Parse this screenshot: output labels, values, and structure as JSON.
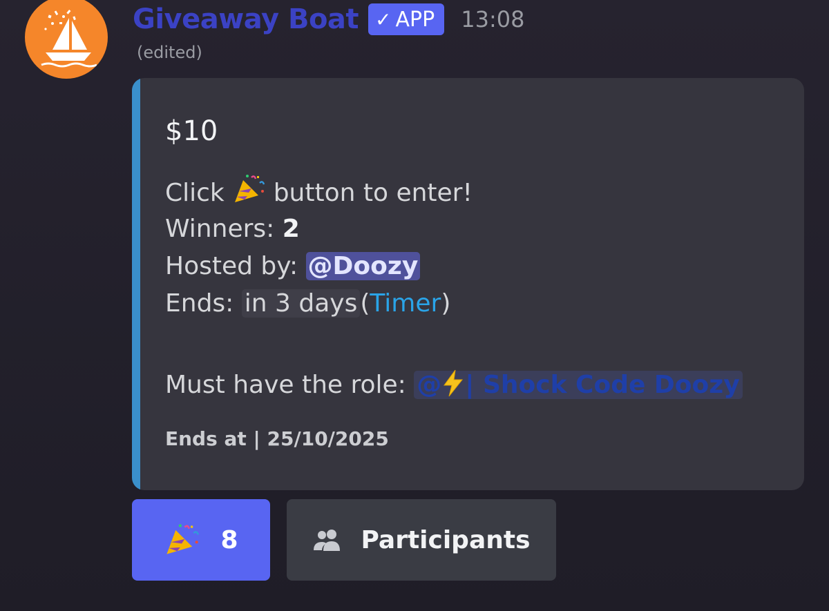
{
  "message": {
    "author": "Giveaway Boat",
    "badge": {
      "check": "✓",
      "label": "APP"
    },
    "timestamp": "13:08",
    "edited": "(edited)",
    "avatar_icon": "sailboat-confetti-icon"
  },
  "embed": {
    "accent_color": "#3a8fcb",
    "title": "$10",
    "line1": {
      "before": "Click",
      "emoji": "party-popper-icon",
      "after": "button to enter!"
    },
    "winners": {
      "label": "Winners:",
      "value": "2"
    },
    "host": {
      "label": "Hosted by:",
      "mention": "@Doozy"
    },
    "ends": {
      "label": "Ends:",
      "relative": "in 3 days",
      "open_paren": "(",
      "link": "Timer",
      "close_paren": ")"
    },
    "role": {
      "label": "Must have the role:",
      "prefix": "@",
      "emoji": "lightning-icon",
      "name": "| Shock Code Doozy"
    },
    "footer": "Ends at | 25/10/2025"
  },
  "buttons": {
    "enter": {
      "emoji": "party-popper-icon",
      "count": "8",
      "color": "#5865f2"
    },
    "participants": {
      "icon": "people-icon",
      "label": "Participants"
    }
  }
}
